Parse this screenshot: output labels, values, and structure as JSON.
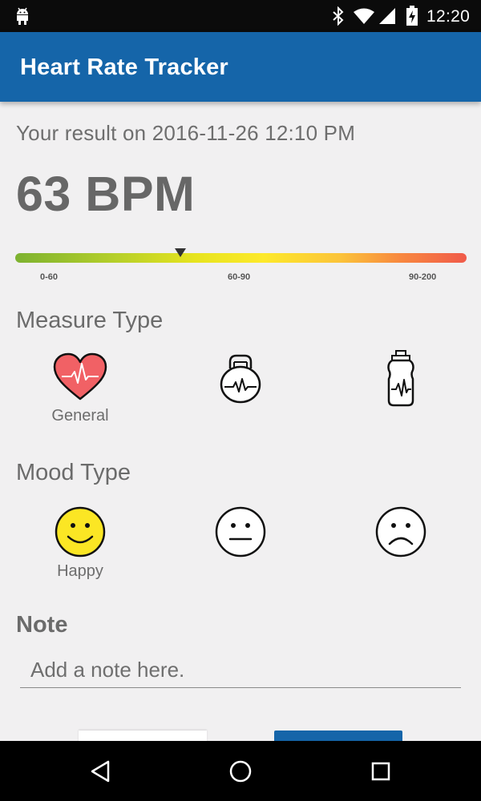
{
  "status_bar": {
    "time": "12:20",
    "icons": [
      "android-debug-icon",
      "bluetooth-icon",
      "wifi-icon",
      "cell-signal-icon",
      "battery-charging-icon"
    ]
  },
  "app_bar": {
    "title": "Heart Rate Tracker"
  },
  "result": {
    "text": "Your result on 2016-11-26 12:10 PM",
    "bpm": "63 BPM",
    "gauge_position_fraction": 0.36,
    "ranges": [
      "0-60",
      "60-90",
      "90-200"
    ],
    "colors": {
      "low": "#7db230",
      "mid": "#fde92b",
      "high": "#f05a4a"
    }
  },
  "measure_type": {
    "title": "Measure Type",
    "options": [
      {
        "icon": "heart-icon",
        "label": "General",
        "selected": true
      },
      {
        "icon": "kettlebell-icon",
        "label": "",
        "selected": false
      },
      {
        "icon": "water-bottle-icon",
        "label": "",
        "selected": false
      }
    ]
  },
  "mood_type": {
    "title": "Mood Type",
    "options": [
      {
        "icon": "happy-face-icon",
        "label": "Happy",
        "selected": true
      },
      {
        "icon": "neutral-face-icon",
        "label": "",
        "selected": false
      },
      {
        "icon": "sad-face-icon",
        "label": "",
        "selected": false
      }
    ]
  },
  "note": {
    "title": "Note",
    "placeholder": "Add a note here."
  },
  "theme": {
    "primary": "#1565a9",
    "heart_fill": "#f16165",
    "happy_fill": "#fbe624"
  },
  "nav_bar": {
    "icons": [
      "back-icon",
      "home-icon",
      "recents-icon"
    ]
  }
}
